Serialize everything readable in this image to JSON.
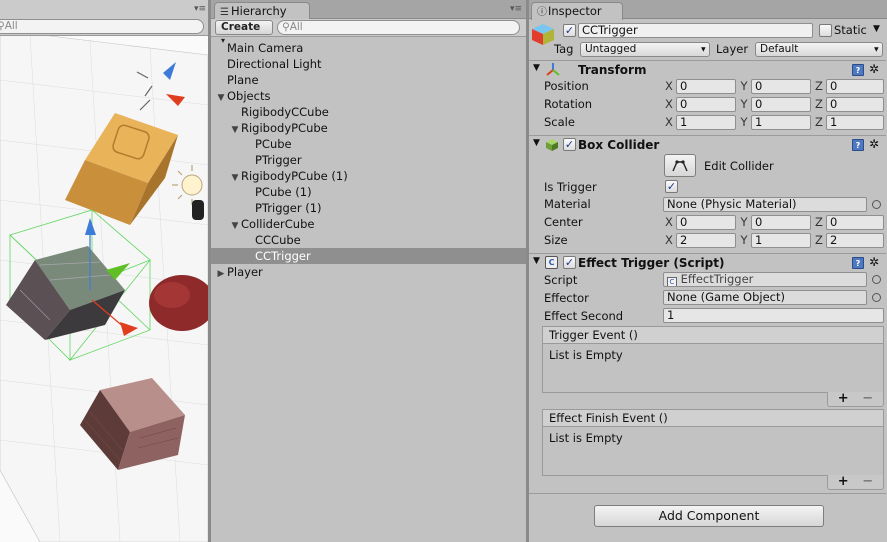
{
  "scene": {
    "search_placeholder": "All"
  },
  "hierarchy": {
    "tab_title": "Hierarchy",
    "create_label": "Create",
    "search_placeholder": "All",
    "items": [
      {
        "label": "Main Camera",
        "depth": 0,
        "arrow": ""
      },
      {
        "label": "Directional Light",
        "depth": 0,
        "arrow": ""
      },
      {
        "label": "Plane",
        "depth": 0,
        "arrow": ""
      },
      {
        "label": "Objects",
        "depth": 0,
        "arrow": "expanded"
      },
      {
        "label": "RigibodyCCube",
        "depth": 1,
        "arrow": ""
      },
      {
        "label": "RigibodyPCube",
        "depth": 1,
        "arrow": "expanded"
      },
      {
        "label": "PCube",
        "depth": 2,
        "arrow": ""
      },
      {
        "label": "PTrigger",
        "depth": 2,
        "arrow": ""
      },
      {
        "label": "RigibodyPCube (1)",
        "depth": 1,
        "arrow": "expanded"
      },
      {
        "label": "PCube (1)",
        "depth": 2,
        "arrow": ""
      },
      {
        "label": "PTrigger (1)",
        "depth": 2,
        "arrow": ""
      },
      {
        "label": "ColliderCube",
        "depth": 1,
        "arrow": "expanded"
      },
      {
        "label": "CCCube",
        "depth": 2,
        "arrow": ""
      },
      {
        "label": "CCTrigger",
        "depth": 2,
        "arrow": "",
        "selected": true
      },
      {
        "label": "Player",
        "depth": 0,
        "arrow": "collapsed"
      }
    ]
  },
  "inspector": {
    "tab_title": "Inspector",
    "object_name": "CCTrigger",
    "static_label": "Static",
    "tag_label": "Tag",
    "tag_value": "Untagged",
    "layer_label": "Layer",
    "layer_value": "Default",
    "transform": {
      "title": "Transform",
      "position_label": "Position",
      "position": {
        "x": "0",
        "y": "0",
        "z": "0"
      },
      "rotation_label": "Rotation",
      "rotation": {
        "x": "0",
        "y": "0",
        "z": "0"
      },
      "scale_label": "Scale",
      "scale": {
        "x": "1",
        "y": "1",
        "z": "1"
      }
    },
    "box_collider": {
      "title": "Box Collider",
      "edit_label": "Edit Collider",
      "is_trigger_label": "Is Trigger",
      "material_label": "Material",
      "material_value": "None (Physic Material)",
      "center_label": "Center",
      "center": {
        "x": "0",
        "y": "0",
        "z": "0"
      },
      "size_label": "Size",
      "size": {
        "x": "2",
        "y": "1",
        "z": "2"
      }
    },
    "effect_trigger": {
      "title": "Effect Trigger (Script)",
      "script_label": "Script",
      "script_value": "EffectTrigger",
      "effector_label": "Effector",
      "effector_value": "None (Game Object)",
      "second_label": "Effect Second",
      "second_value": "1",
      "trigger_event_title": "Trigger Event ()",
      "trigger_event_empty": "List is Empty",
      "finish_event_title": "Effect Finish Event ()",
      "finish_event_empty": "List is Empty"
    },
    "add_component_label": "Add Component"
  },
  "axes": {
    "x": "X",
    "y": "Y",
    "z": "Z"
  },
  "plus": "+",
  "minus": "−"
}
